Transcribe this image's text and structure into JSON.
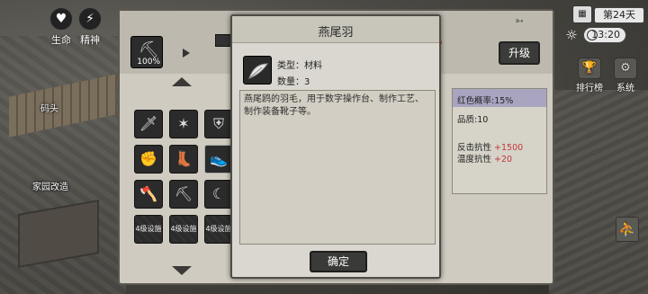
{
  "hud": {
    "stat_life": "生命",
    "stat_spirit": "精神",
    "map_label_dock": "码头",
    "map_label_home": "家园改造",
    "calendar_icon": "calendar-icon",
    "day": "第24天",
    "time": "13:20",
    "ranking": "排行榜",
    "system": "系统"
  },
  "craft_panel": {
    "top_item_pct": "100%",
    "upgrade_label": "升级",
    "locked_slot_label": "4级设施",
    "stats": {
      "red_prob": "红色概率:15%",
      "quality": "品质:10",
      "counter_res_label": "反击抗性",
      "counter_res_value": "+1500",
      "temp_res_label": "温度抗性",
      "temp_res_value": "+20"
    }
  },
  "modal": {
    "title": "燕尾羽",
    "type_line": "类型：材料",
    "count_line": "数量：3",
    "description": "燕尾鸥的羽毛，用于数字操作台、制作工艺、制作装备靴子等。",
    "confirm_label": "确定"
  },
  "colors": {
    "accent_red": "#c0393b",
    "panel_bg": "#cfcbc0",
    "modal_bg": "#d9d7cf"
  }
}
